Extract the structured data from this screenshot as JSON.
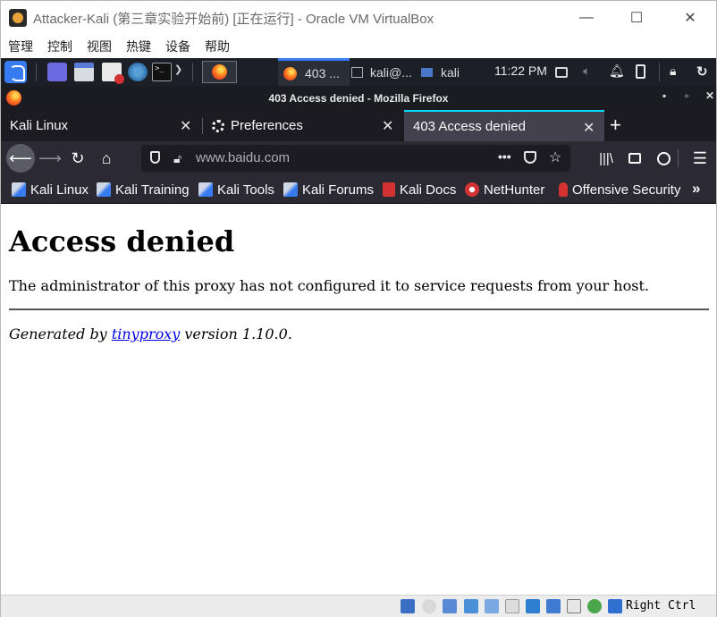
{
  "host_window": {
    "title": "Attacker-Kali (第三章实验开始前) [正在运行] - Oracle VM VirtualBox",
    "menu": [
      "管理",
      "控制",
      "视图",
      "热键",
      "设备",
      "帮助"
    ],
    "controls": {
      "minimize": "—",
      "maximize": "☐",
      "close": "✕"
    }
  },
  "kali_panel": {
    "tasks": [
      {
        "label": "403 ...",
        "icon": "firefox-icon"
      },
      {
        "label": "kali@...",
        "icon": "terminal-icon"
      },
      {
        "label": "kali",
        "icon": "folder-icon"
      }
    ],
    "clock": "11:22 PM"
  },
  "firefox": {
    "window_title": "403 Access denied - Mozilla Firefox",
    "tabs": [
      {
        "label": "Kali Linux",
        "active": false
      },
      {
        "label": "Preferences",
        "active": false
      },
      {
        "label": "403 Access denied",
        "active": true
      }
    ],
    "url": "www.baidu.com",
    "bookmarks": [
      "Kali Linux",
      "Kali Training",
      "Kali Tools",
      "Kali Forums",
      "Kali Docs",
      "NetHunter",
      "Offensive Security"
    ]
  },
  "page": {
    "heading": "Access denied",
    "message": "The administrator of this proxy has not configured it to service requests from your host.",
    "footer_prefix": "Generated by ",
    "footer_link": "tinyproxy",
    "footer_suffix": " version 1.10.0."
  },
  "status_bar": {
    "host_key": "Right Ctrl"
  }
}
